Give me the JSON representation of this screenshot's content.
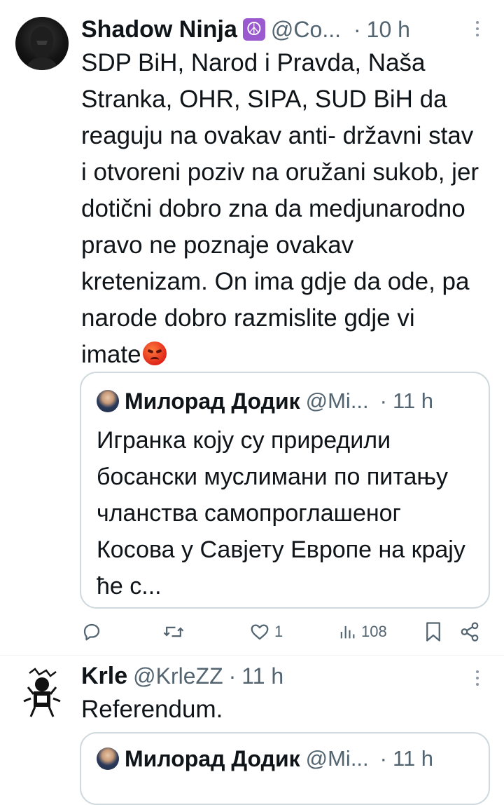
{
  "tweet1": {
    "display_name": "Shadow Ninja",
    "badge_emoji": "☮",
    "handle": "@Co...",
    "separator": "·",
    "time": "10 h",
    "text": "SDP BiH, Narod i Pravda, Naša Stranka, OHR, SIPA, SUD BiH da reaguju na ovakav anti- državni stav i otvoreni poziv na oružani sukob, jer dotični dobro zna da medjunarodno pravo ne poznaje ovakav kretenizam. On ima gdje da ode, pa narode dobro razmislite gdje vi imate",
    "quote": {
      "display_name": "Милорад Додик",
      "handle": "@Mi...",
      "separator": "·",
      "time": "11 h",
      "text": "Игранка коју су приредили босански муслимани по питању чланства самопроглашеног Косова у Савјету Европе на крају ће с..."
    },
    "actions": {
      "reply_count": "",
      "retweet_count": "",
      "like_count": "1",
      "views_count": "108"
    }
  },
  "tweet2": {
    "display_name": "Krle",
    "handle": "@KrleZZ",
    "separator": "·",
    "time": "11 h",
    "text": "Referendum.",
    "quote": {
      "display_name": "Милорад Додик",
      "handle": "@Mi...",
      "separator": "·",
      "time": "11 h"
    }
  },
  "colors": {
    "text": "#0f1419",
    "muted": "#536471",
    "border": "#cfd9de",
    "badge_bg": "#9b59d0"
  }
}
